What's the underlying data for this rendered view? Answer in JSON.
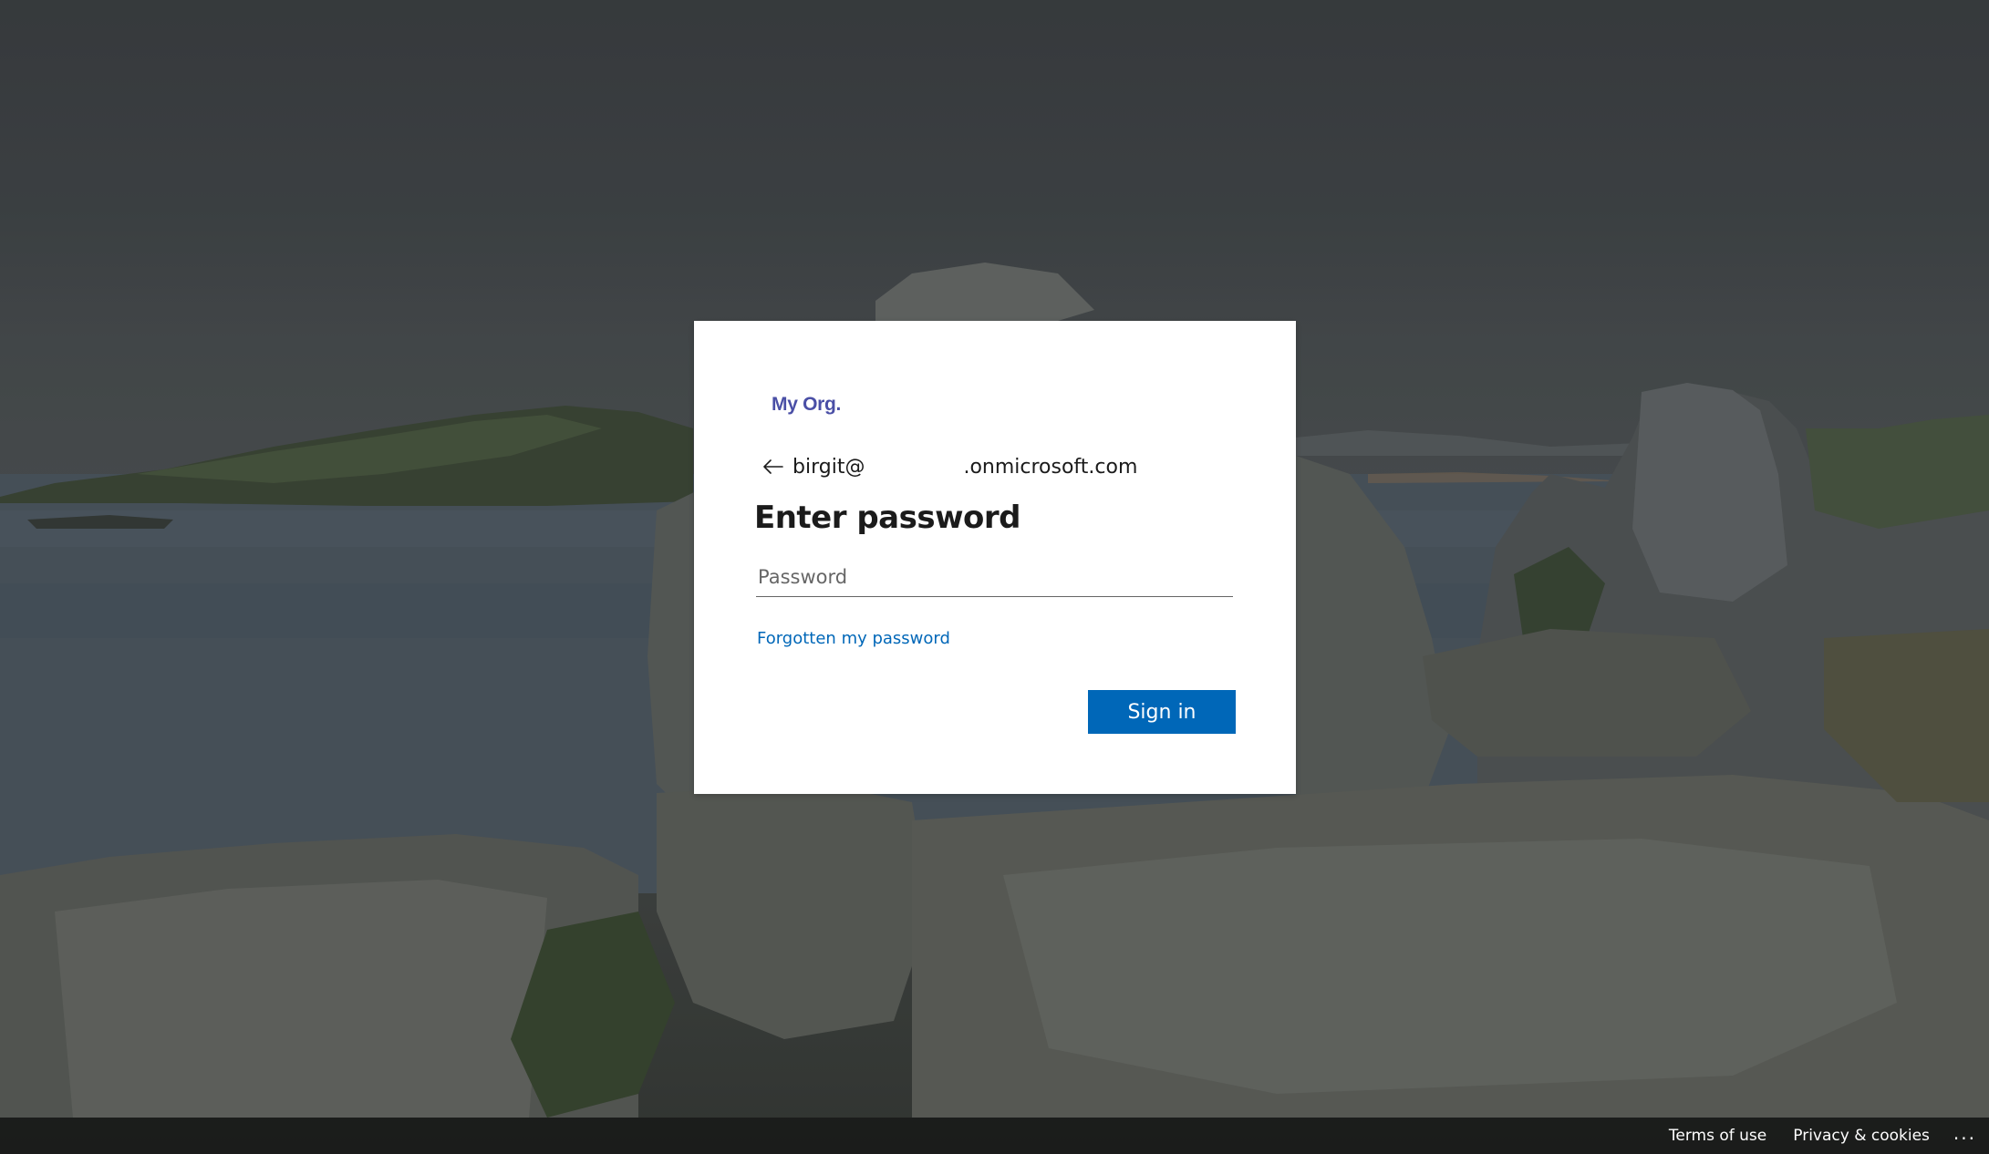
{
  "brand": {
    "logo_text": "My Org."
  },
  "identity": {
    "prefix": "birgit@",
    "suffix": ".onmicrosoft.com"
  },
  "title": "Enter password",
  "password_field": {
    "placeholder": "Password",
    "value": ""
  },
  "forgot_link": "Forgotten my password",
  "signin_button": "Sign in",
  "footer": {
    "terms": "Terms of use",
    "privacy": "Privacy & cookies",
    "more": "..."
  },
  "colors": {
    "accent": "#0067b8",
    "brand": "#4a4fa6",
    "text": "#1b1b1b",
    "card": "#ffffff"
  }
}
